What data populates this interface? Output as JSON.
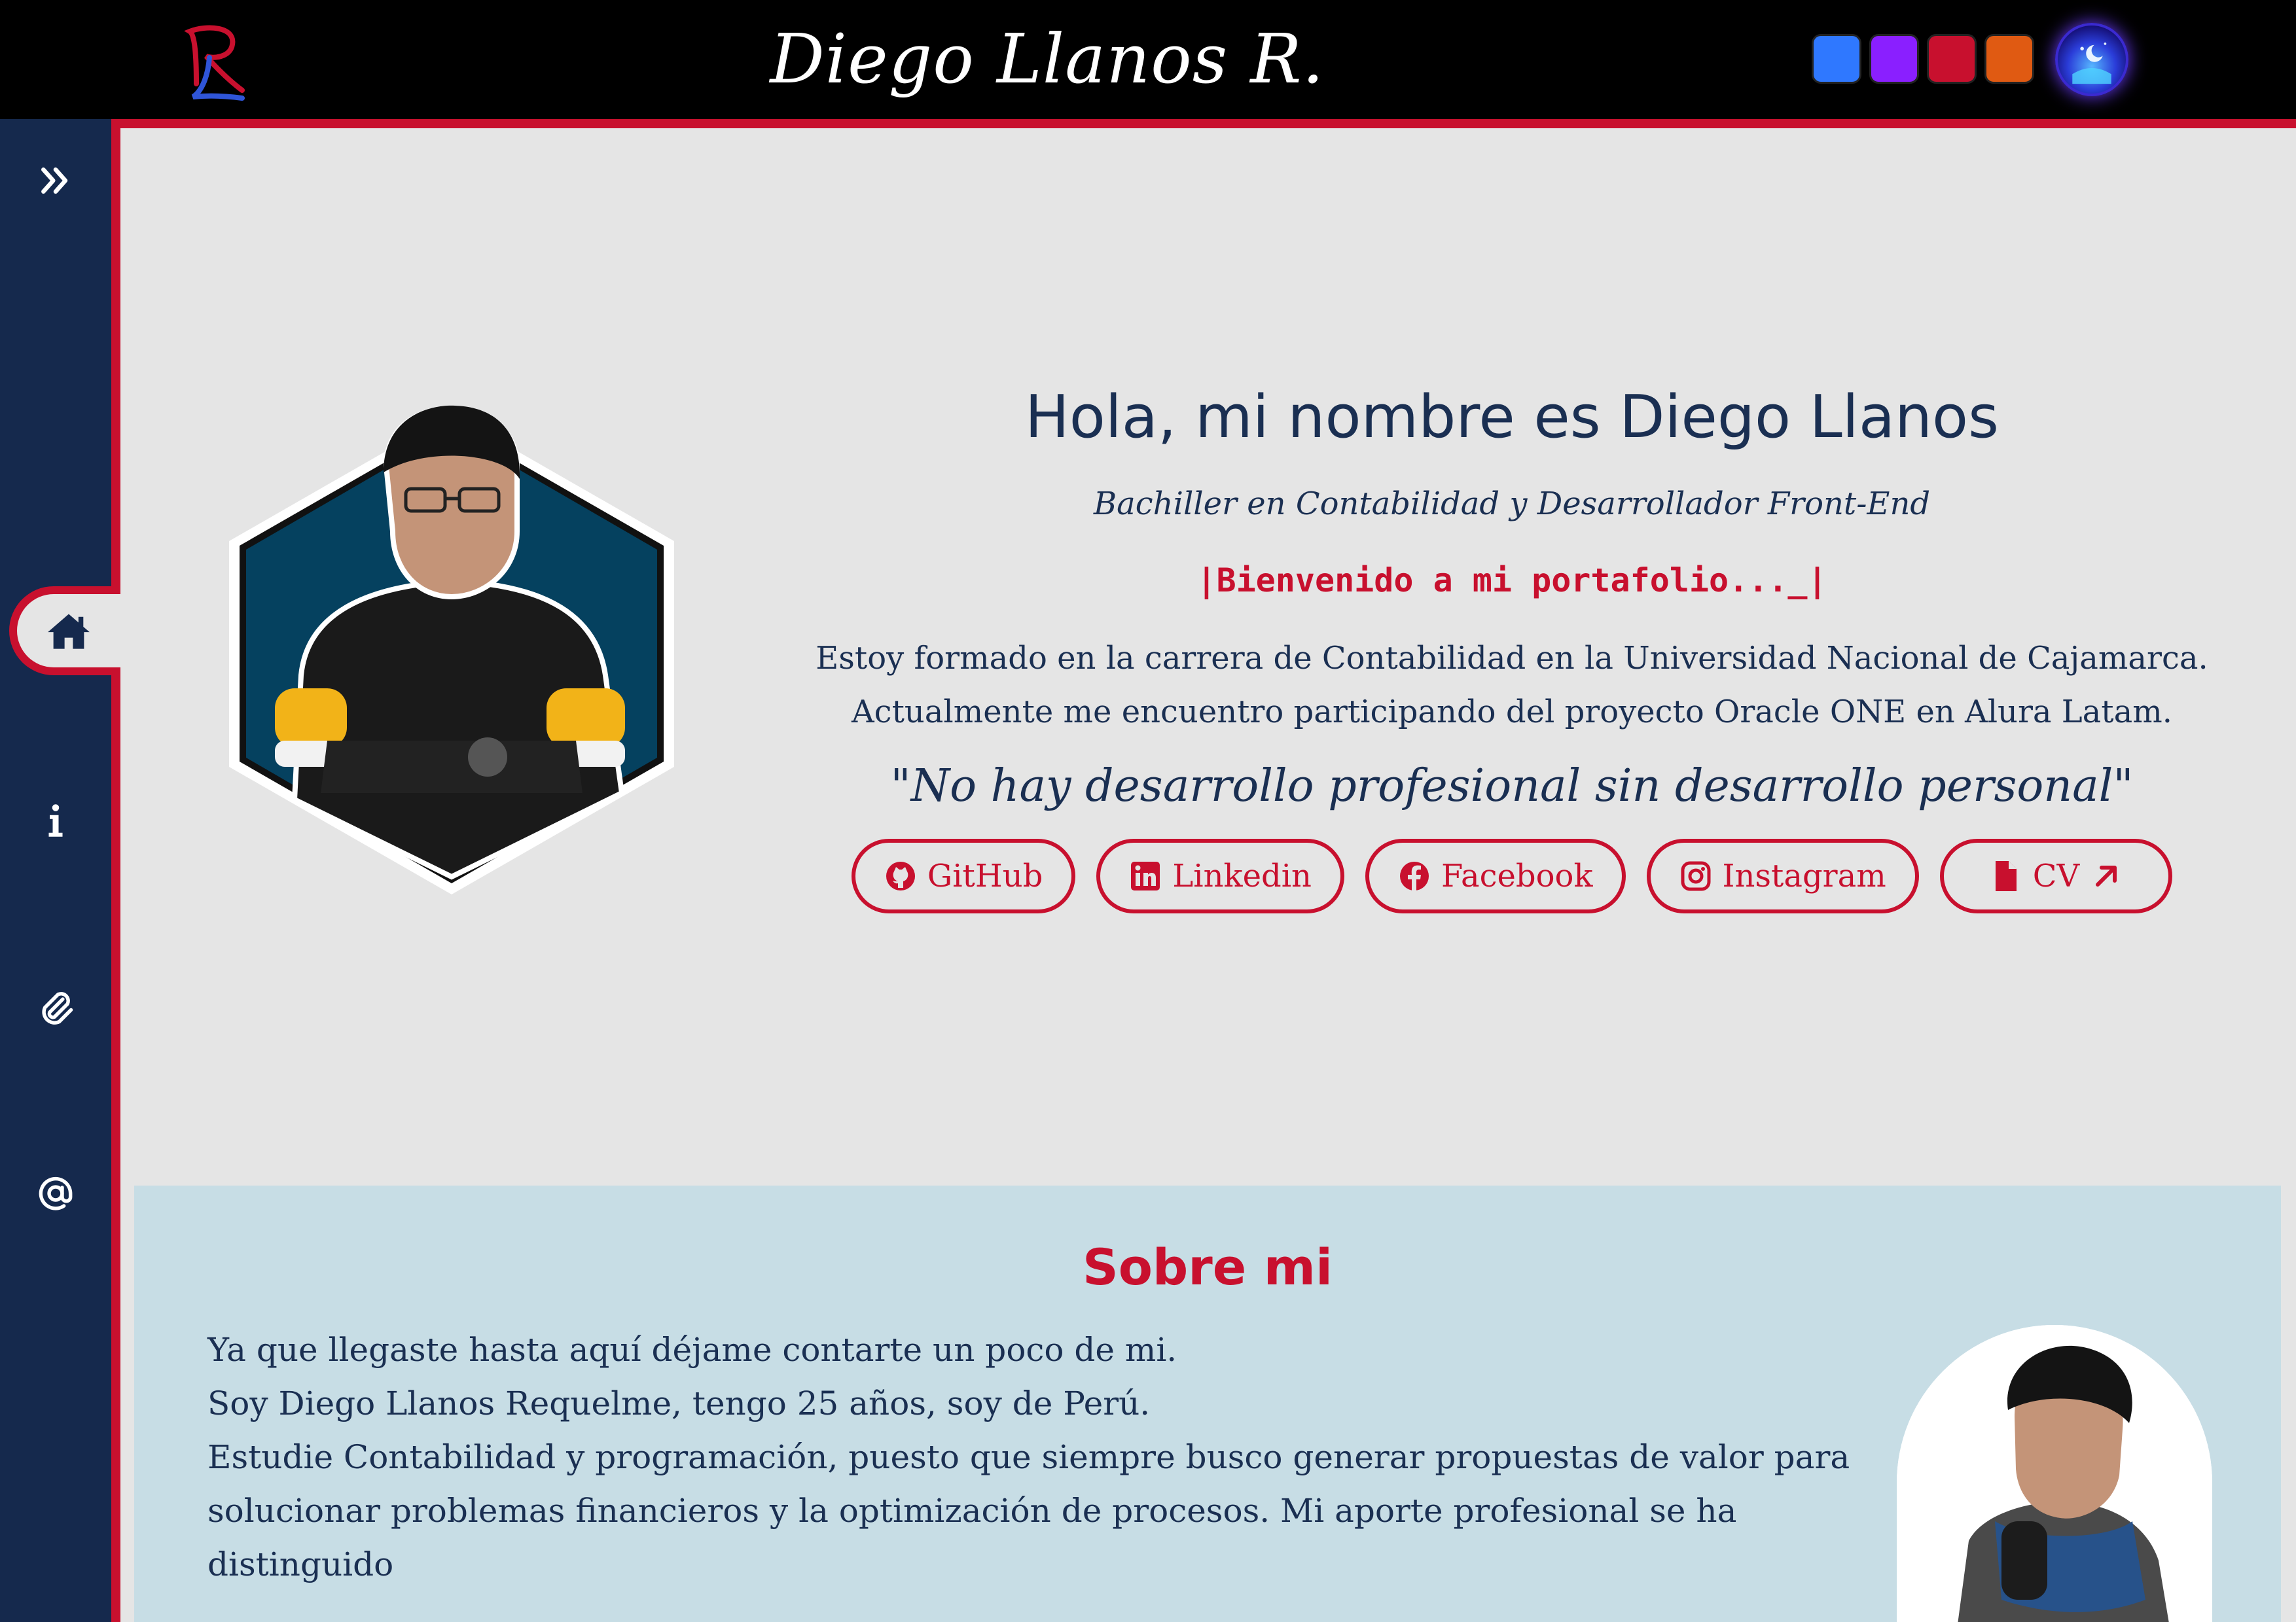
{
  "header": {
    "logo_text": "RL",
    "title": "Diego Llanos R.",
    "theme_swatches": [
      "#2f78ff",
      "#8a1fff",
      "#c8102e",
      "#e05a12"
    ],
    "theme_toggle_icon": "moon-icon"
  },
  "sidebar": {
    "items": [
      {
        "icon": "double-chevron-right-icon"
      },
      {
        "icon": "home-icon",
        "active": true
      },
      {
        "icon": "info-icon"
      },
      {
        "icon": "paperclip-icon"
      },
      {
        "icon": "at-sign-icon"
      }
    ]
  },
  "hero": {
    "title": "Hola, mi nombre es Diego Llanos",
    "subtitle": "Bachiller en Contabilidad y Desarrollador Front-End",
    "welcome": "|Bienvenido a mi portafolio..._|",
    "description_line1": "Estoy formado en la carrera de Contabilidad en la Universidad Nacional de Cajamarca.",
    "description_line2": "Actualmente me encuentro participando del proyecto Oracle ONE en Alura Latam.",
    "quote": "\"No hay desarrollo profesional sin desarrollo personal\"",
    "links": [
      {
        "label": "GitHub",
        "icon": "github-icon"
      },
      {
        "label": "Linkedin",
        "icon": "linkedin-icon"
      },
      {
        "label": "Facebook",
        "icon": "facebook-icon"
      },
      {
        "label": "Instagram",
        "icon": "instagram-icon"
      },
      {
        "label": "CV",
        "icon": "file-icon"
      }
    ]
  },
  "about": {
    "title": "Sobre mi",
    "line1": "Ya que llegaste hasta aquí déjame contarte un poco de mi.",
    "line2": "Soy Diego Llanos Requelme, tengo 25 años, soy de Perú.",
    "line3": "Estudie Contabilidad y programación, puesto que siempre busco generar propuestas de valor para",
    "line4": "solucionar problemas financieros y la optimización de procesos. Mi aporte profesional se ha distinguido"
  },
  "colors": {
    "accent": "#c8102e",
    "navy": "#15294d",
    "text": "#1a2f52",
    "background": "#e5e5e5",
    "about_bg": "#c7dde5"
  }
}
